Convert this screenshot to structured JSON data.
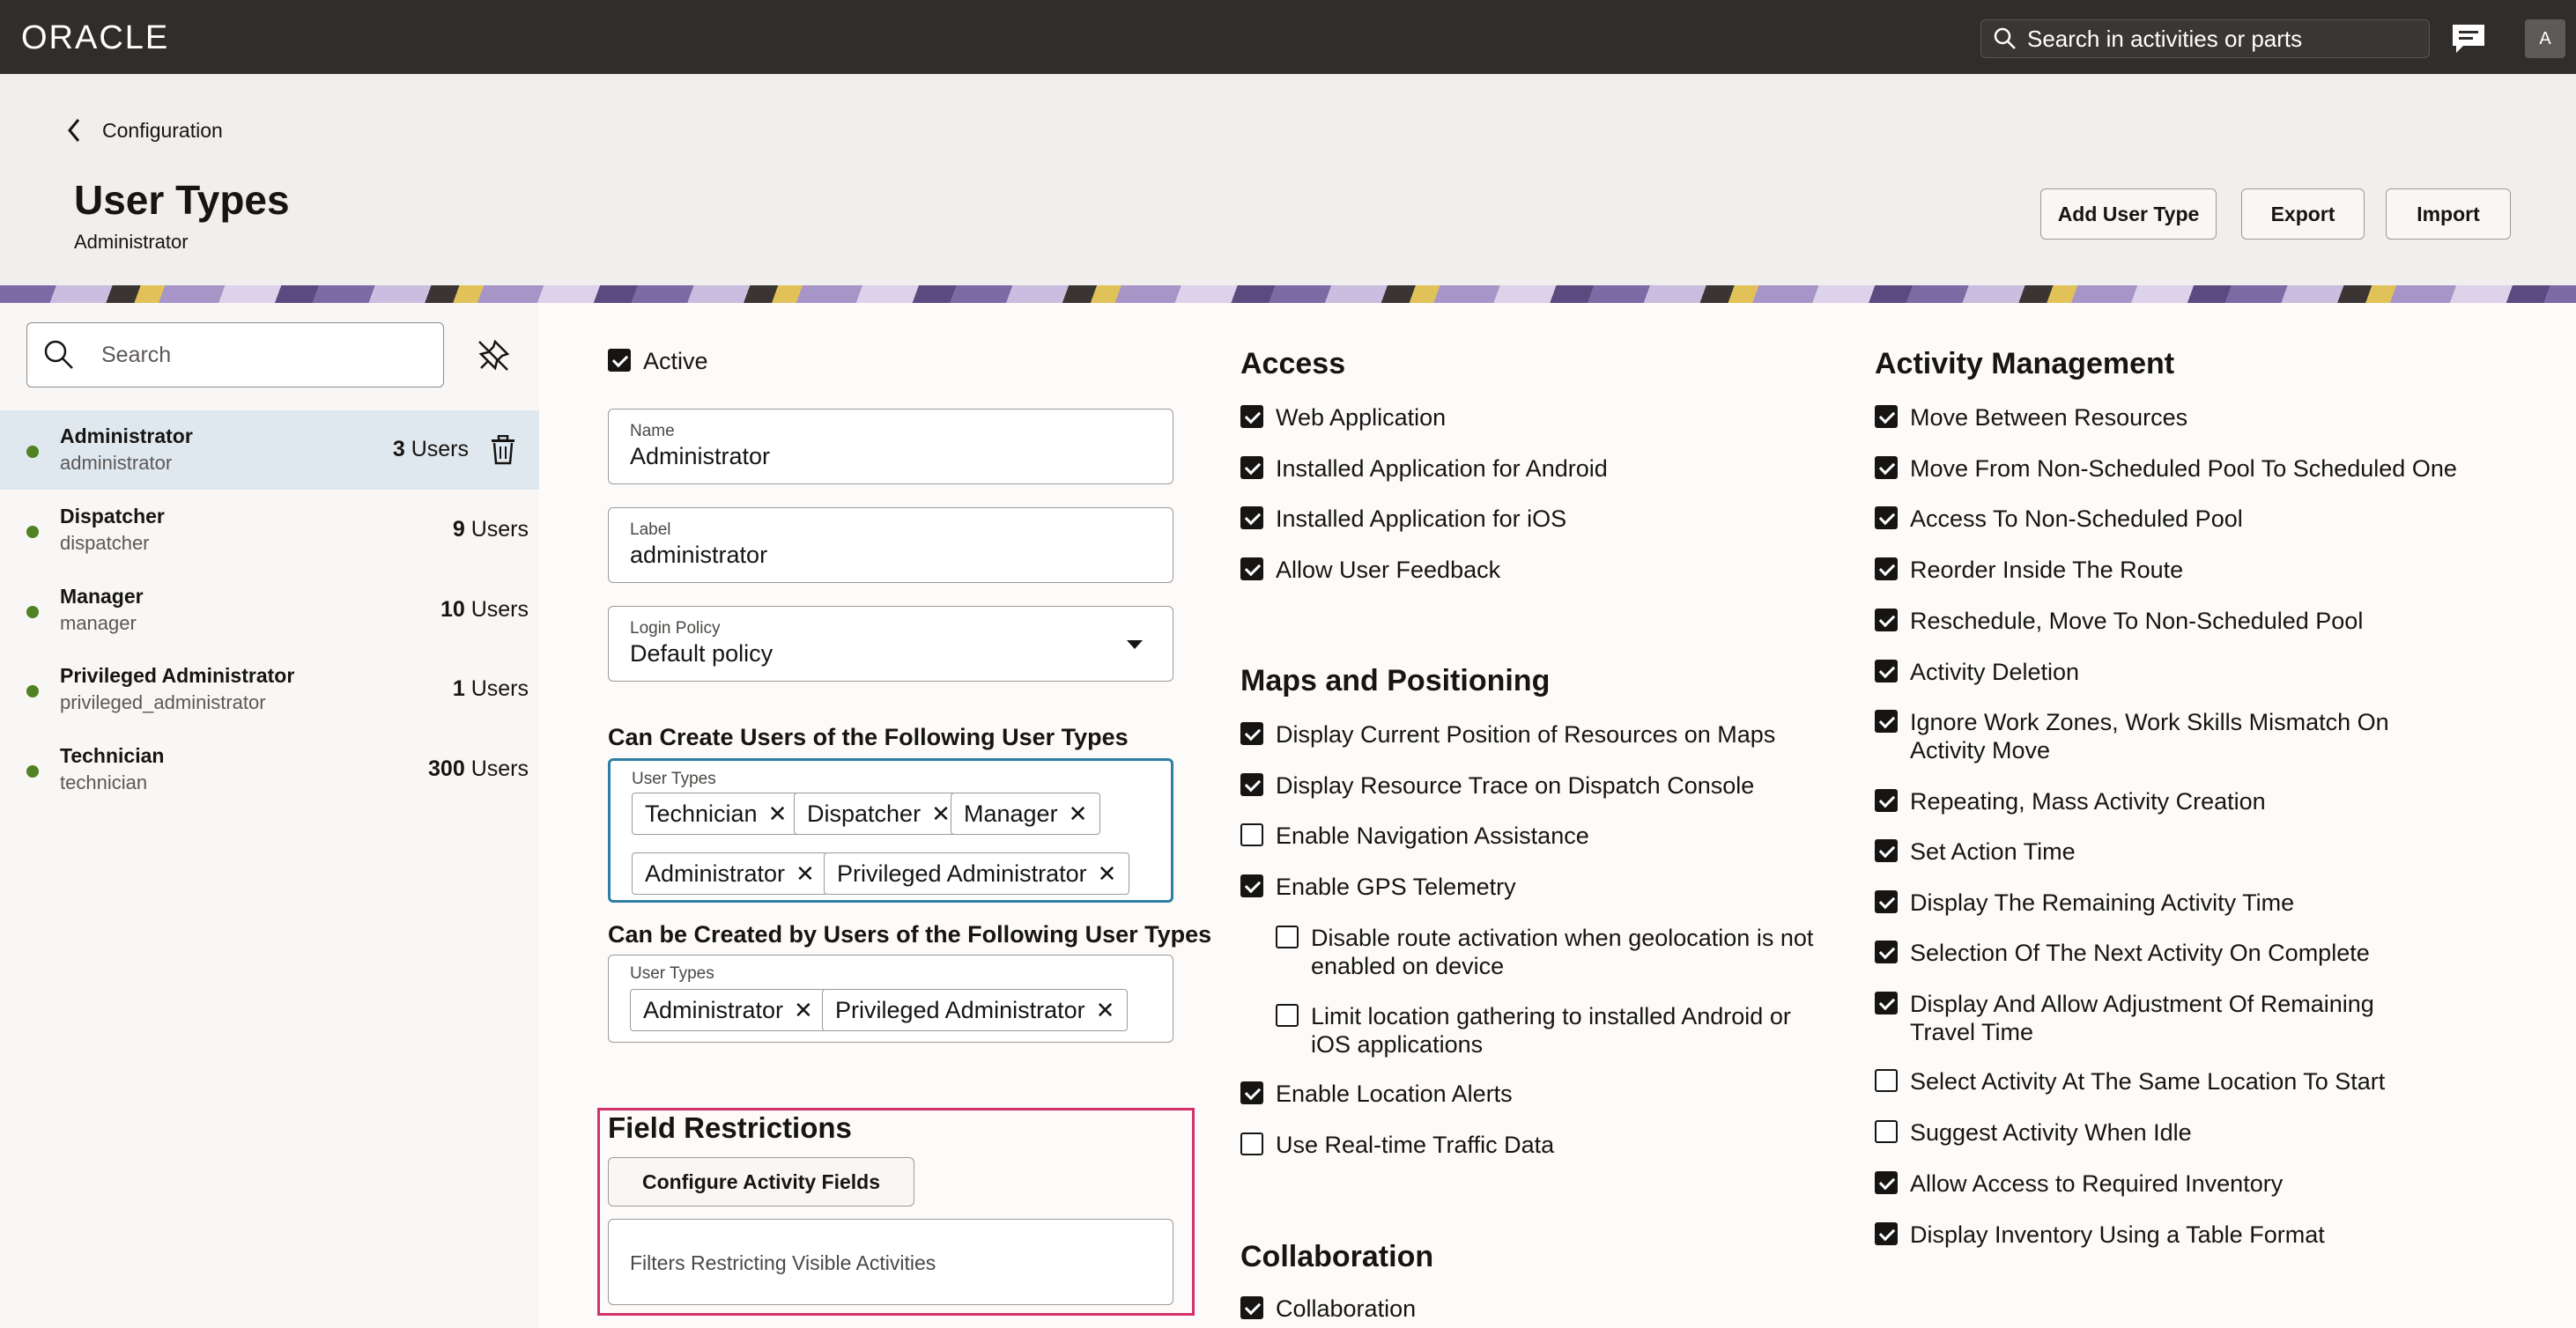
{
  "header": {
    "logo": "ORACLE",
    "search_placeholder": "Search in activities or parts",
    "avatar_initial": "A"
  },
  "page": {
    "breadcrumb": "Configuration",
    "title": "User Types",
    "subtitle": "Administrator",
    "buttons": {
      "add": "Add User Type",
      "export": "Export",
      "import": "Import"
    }
  },
  "sidebar": {
    "search_placeholder": "Search",
    "items": [
      {
        "name": "Administrator",
        "id": "administrator",
        "count": "3",
        "unit": "Users",
        "selected": true
      },
      {
        "name": "Dispatcher",
        "id": "dispatcher",
        "count": "9",
        "unit": "Users"
      },
      {
        "name": "Manager",
        "id": "manager",
        "count": "10",
        "unit": "Users"
      },
      {
        "name": "Privileged Administrator",
        "id": "privileged_administrator",
        "count": "1",
        "unit": "Users"
      },
      {
        "name": "Technician",
        "id": "technician",
        "count": "300",
        "unit": "Users"
      }
    ]
  },
  "form": {
    "active_label": "Active",
    "active": true,
    "name": {
      "label": "Name",
      "value": "Administrator"
    },
    "label_field": {
      "label": "Label",
      "value": "administrator"
    },
    "login_policy": {
      "label": "Login Policy",
      "value": "Default policy"
    },
    "can_create": {
      "title": "Can Create Users of the Following User Types",
      "field_label": "User Types",
      "chips": [
        "Technician",
        "Dispatcher",
        "Manager",
        "Administrator",
        "Privileged Administrator"
      ]
    },
    "created_by": {
      "title": "Can be Created by Users of the Following User Types",
      "field_label": "User Types",
      "chips": [
        "Administrator",
        "Privileged Administrator"
      ]
    },
    "field_restrictions": {
      "title": "Field Restrictions",
      "configure_button": "Configure Activity Fields",
      "filters_label": "Filters Restricting Visible Activities"
    }
  },
  "access": {
    "title": "Access",
    "items": [
      {
        "label": "Web Application",
        "checked": true
      },
      {
        "label": "Installed Application for Android",
        "checked": true
      },
      {
        "label": "Installed Application for iOS",
        "checked": true
      },
      {
        "label": "Allow User Feedback",
        "checked": true
      }
    ]
  },
  "maps": {
    "title": "Maps and Positioning",
    "items": [
      {
        "label": "Display Current Position of Resources on Maps",
        "checked": true
      },
      {
        "label": "Display Resource Trace on Dispatch Console",
        "checked": true
      },
      {
        "label": "Enable Navigation Assistance",
        "checked": false
      },
      {
        "label": "Enable GPS Telemetry",
        "checked": true
      },
      {
        "label": "Disable route activation when geolocation is not enabled on device",
        "checked": false
      },
      {
        "label": "Limit location gathering to installed Android or iOS applications",
        "checked": false
      },
      {
        "label": "Enable Location Alerts",
        "checked": true
      },
      {
        "label": "Use Real-time Traffic Data",
        "checked": false
      }
    ]
  },
  "collaboration": {
    "title": "Collaboration",
    "items": [
      {
        "label": "Collaboration",
        "checked": true
      }
    ]
  },
  "activity_management": {
    "title": "Activity Management",
    "items": [
      {
        "label": "Move Between Resources",
        "checked": true
      },
      {
        "label": "Move From Non-Scheduled Pool To Scheduled One",
        "checked": true
      },
      {
        "label": "Access To Non-Scheduled Pool",
        "checked": true
      },
      {
        "label": "Reorder Inside The Route",
        "checked": true
      },
      {
        "label": "Reschedule, Move To Non-Scheduled Pool",
        "checked": true
      },
      {
        "label": "Activity Deletion",
        "checked": true
      },
      {
        "label": "Ignore Work Zones, Work Skills Mismatch On Activity Move",
        "checked": true
      },
      {
        "label": "Repeating, Mass Activity Creation",
        "checked": true
      },
      {
        "label": "Set Action Time",
        "checked": true
      },
      {
        "label": "Display The Remaining Activity Time",
        "checked": true
      },
      {
        "label": "Selection Of The Next Activity On Complete",
        "checked": true
      },
      {
        "label": "Display And Allow Adjustment Of Remaining Travel Time",
        "checked": true
      },
      {
        "label": "Select Activity At The Same Location To Start",
        "checked": false
      },
      {
        "label": "Suggest Activity When Idle",
        "checked": false
      },
      {
        "label": "Allow Access to Required Inventory",
        "checked": true
      },
      {
        "label": "Display Inventory Using a Table Format",
        "checked": true
      }
    ]
  }
}
